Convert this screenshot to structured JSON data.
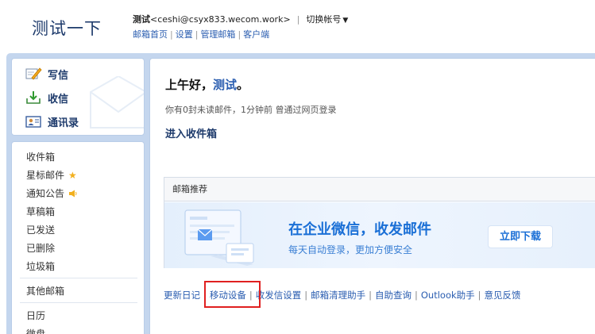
{
  "header": {
    "logo": "测试一下",
    "user_name": "测试",
    "user_email": "<ceshi@csyx833.wecom.work>",
    "switch_account": "切换帐号",
    "nav": [
      "邮箱首页",
      "设置",
      "管理邮箱",
      "客户端"
    ]
  },
  "sidebar": {
    "compose": {
      "label": "写信",
      "icon": "pencil-icon"
    },
    "receive": {
      "label": "收信",
      "icon": "inbox-download-icon"
    },
    "contacts": {
      "label": "通讯录",
      "icon": "contact-card-icon"
    },
    "folders": [
      {
        "label": "收件箱"
      },
      {
        "label": "星标邮件",
        "icon": "star-icon"
      },
      {
        "label": "通知公告",
        "icon": "speaker-icon"
      },
      {
        "label": "草稿箱"
      },
      {
        "label": "已发送"
      },
      {
        "label": "已删除"
      },
      {
        "label": "垃圾箱"
      },
      {
        "label": "其他邮箱"
      },
      {
        "label": "日历"
      },
      {
        "label": "微盘"
      }
    ]
  },
  "main": {
    "greeting_prefix": "上午好，",
    "greeting_name": "测试",
    "greeting_suffix": "。",
    "unread_info": "你有0封未读邮件，1分钟前 曾通过网页登录",
    "inbox_link": "进入收件箱",
    "recommend_title": "邮箱推荐",
    "banner_title": "在企业微信，收发邮件",
    "banner_subtitle": "每天自动登录，更加方便安全",
    "download_button": "立即下载",
    "bottom_links": [
      "更新日记",
      "移动设备",
      "收发信设置",
      "邮箱清理助手",
      "自助查询",
      "Outlook助手",
      "意见反馈"
    ]
  },
  "colors": {
    "frame_blue": "#c4d6ee",
    "link_blue": "#2a5db0",
    "banner_blue": "#1a6fd6",
    "highlight_red": "#e02020"
  }
}
